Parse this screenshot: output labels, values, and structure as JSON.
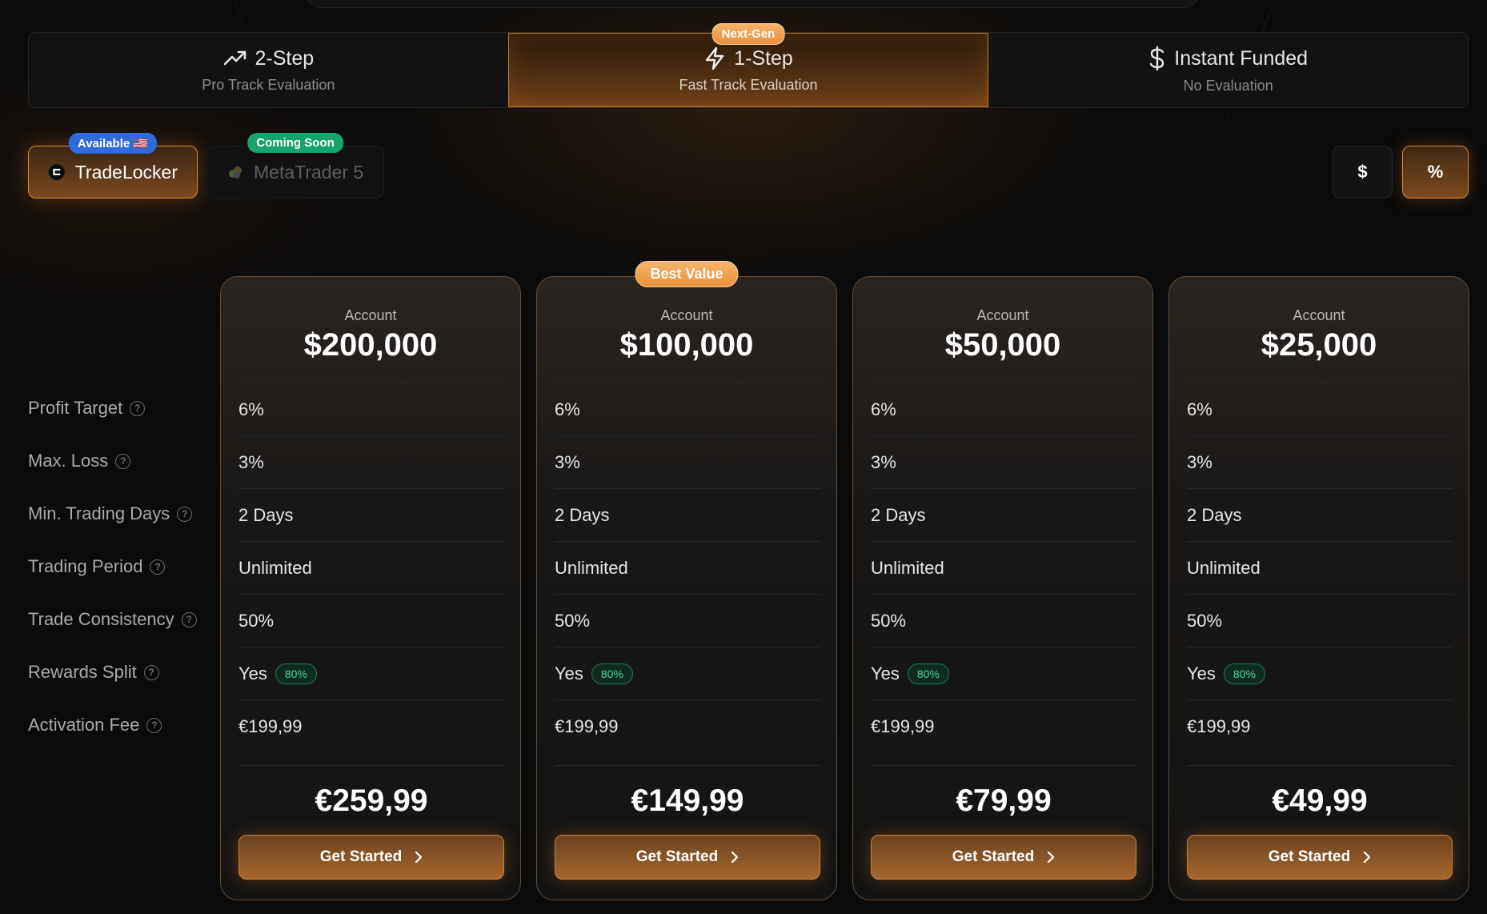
{
  "tabs": [
    {
      "title": "2-Step",
      "subtitle": "Pro Track Evaluation",
      "icon": "trending-up-icon"
    },
    {
      "title": "1-Step",
      "subtitle": "Fast Track Evaluation",
      "icon": "lightning-icon",
      "badge": "Next-Gen"
    },
    {
      "title": "Instant Funded",
      "subtitle": "No Evaluation",
      "icon": "dollar-icon"
    }
  ],
  "platforms": {
    "tradelocker": {
      "label": "TradeLocker",
      "badge": "Available 🇺🇸"
    },
    "metatrader": {
      "label": "MetaTrader 5",
      "badge": "Coming Soon"
    }
  },
  "toggles": {
    "dollar": "$",
    "percent": "%"
  },
  "row_labels": [
    "Profit Target",
    "Max. Loss",
    "Min. Trading Days",
    "Trading Period",
    "Trade Consistency",
    "Rewards Split",
    "Activation Fee"
  ],
  "cards": [
    {
      "account_label": "Account",
      "account": "$200,000",
      "profit_target": "6%",
      "max_loss": "3%",
      "min_days": "2 Days",
      "period": "Unlimited",
      "consistency": "50%",
      "rewards": "Yes",
      "split": "80%",
      "activation_fee": "€199,99",
      "price": "€259,99",
      "cta": "Get Started"
    },
    {
      "account_label": "Account",
      "account": "$100,000",
      "badge": "Best Value",
      "profit_target": "6%",
      "max_loss": "3%",
      "min_days": "2 Days",
      "period": "Unlimited",
      "consistency": "50%",
      "rewards": "Yes",
      "split": "80%",
      "activation_fee": "€199,99",
      "price": "€149,99",
      "cta": "Get Started"
    },
    {
      "account_label": "Account",
      "account": "$50,000",
      "profit_target": "6%",
      "max_loss": "3%",
      "min_days": "2 Days",
      "period": "Unlimited",
      "consistency": "50%",
      "rewards": "Yes",
      "split": "80%",
      "activation_fee": "€199,99",
      "price": "€79,99",
      "cta": "Get Started"
    },
    {
      "account_label": "Account",
      "account": "$25,000",
      "profit_target": "6%",
      "max_loss": "3%",
      "min_days": "2 Days",
      "period": "Unlimited",
      "consistency": "50%",
      "rewards": "Yes",
      "split": "80%",
      "activation_fee": "€199,99",
      "price": "€49,99",
      "cta": "Get Started"
    }
  ],
  "colors": {
    "accent": "#e9913c",
    "background": "#0b0b0c",
    "success": "#4fd39a",
    "blue_badge": "#2f6bd9"
  }
}
